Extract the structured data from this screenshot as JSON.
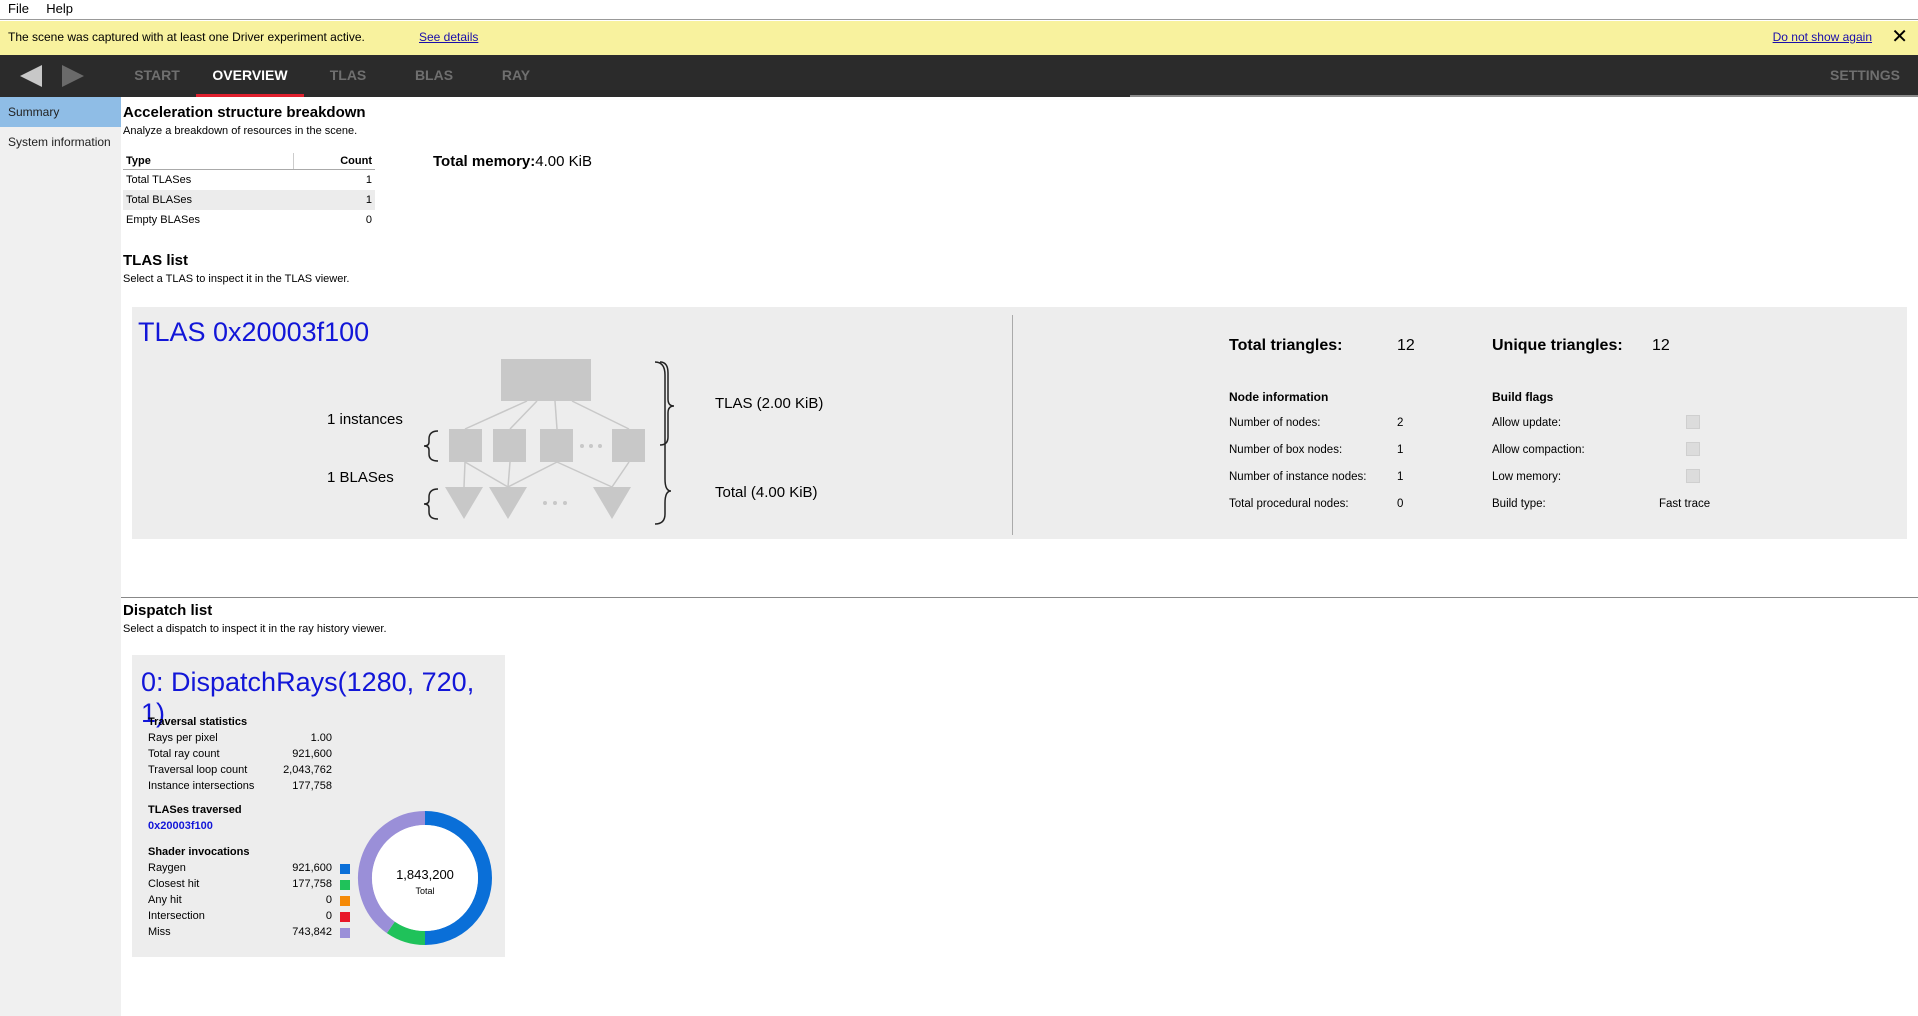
{
  "menu": {
    "file": "File",
    "help": "Help"
  },
  "banner": {
    "message": "The scene was captured with at least one Driver experiment active.",
    "details_link": "See details",
    "dismiss_link": "Do not show again",
    "close": "✕"
  },
  "nav": {
    "tabs": [
      {
        "label": "START"
      },
      {
        "label": "OVERVIEW"
      },
      {
        "label": "TLAS"
      },
      {
        "label": "BLAS"
      },
      {
        "label": "RAY"
      }
    ],
    "settings": "SETTINGS"
  },
  "sidebar": {
    "items": [
      {
        "label": "Summary"
      },
      {
        "label": "System information"
      }
    ]
  },
  "breakdown": {
    "title": "Acceleration structure breakdown",
    "subtitle": "Analyze a breakdown of resources in the scene.",
    "col_type": "Type",
    "col_count": "Count",
    "rows": [
      {
        "type": "Total TLASes",
        "count": "1"
      },
      {
        "type": "Total BLASes",
        "count": "1"
      },
      {
        "type": "Empty BLASes",
        "count": "0"
      }
    ],
    "total_memory_label": "Total memory:",
    "total_memory_value": "4.00 KiB"
  },
  "tlas_list": {
    "title": "TLAS list",
    "subtitle": "Select a TLAS to inspect it in the TLAS viewer.",
    "card": {
      "name": "TLAS 0x20003f100",
      "instances": "1 instances",
      "blases": "1 BLASes",
      "tlas_size": "TLAS (2.00 KiB)",
      "total_size": "Total (4.00 KiB)",
      "total_triangles_label": "Total triangles:",
      "total_triangles": "12",
      "unique_triangles_label": "Unique triangles:",
      "unique_triangles": "12",
      "node_info_title": "Node information",
      "node_info": [
        {
          "label": "Number of nodes:",
          "value": "2"
        },
        {
          "label": "Number of box nodes:",
          "value": "1"
        },
        {
          "label": "Number of instance nodes:",
          "value": "1"
        },
        {
          "label": "Total procedural nodes:",
          "value": "0"
        }
      ],
      "build_flags_title": "Build flags",
      "build_flags": [
        {
          "label": "Allow update:"
        },
        {
          "label": "Allow compaction:"
        },
        {
          "label": "Low memory:"
        }
      ],
      "build_type_label": "Build type:",
      "build_type": "Fast trace"
    }
  },
  "dispatch_list": {
    "title": "Dispatch list",
    "subtitle": "Select a dispatch to inspect it in the ray history viewer.",
    "card": {
      "name": "0: DispatchRays(1280, 720, 1)",
      "traversal_title": "Traversal statistics",
      "traversal": [
        {
          "label": "Rays per pixel",
          "value": "1.00"
        },
        {
          "label": "Total ray count",
          "value": "921,600"
        },
        {
          "label": "Traversal loop count",
          "value": "2,043,762"
        },
        {
          "label": "Instance intersections",
          "value": "177,758"
        }
      ],
      "tlases_title": "TLASes traversed",
      "tlas_link": "0x20003f100",
      "shader_title": "Shader invocations",
      "shaders": [
        {
          "label": "Raygen",
          "value": "921,600",
          "color": "#0a6fd8"
        },
        {
          "label": "Closest hit",
          "value": "177,758",
          "color": "#1fc25a"
        },
        {
          "label": "Any hit",
          "value": "0",
          "color": "#f58a07"
        },
        {
          "label": "Intersection",
          "value": "0",
          "color": "#e8182a"
        },
        {
          "label": "Miss",
          "value": "743,842",
          "color": "#9a8fd8"
        }
      ],
      "donut_total": "1,843,200",
      "donut_total_label": "Total"
    }
  }
}
